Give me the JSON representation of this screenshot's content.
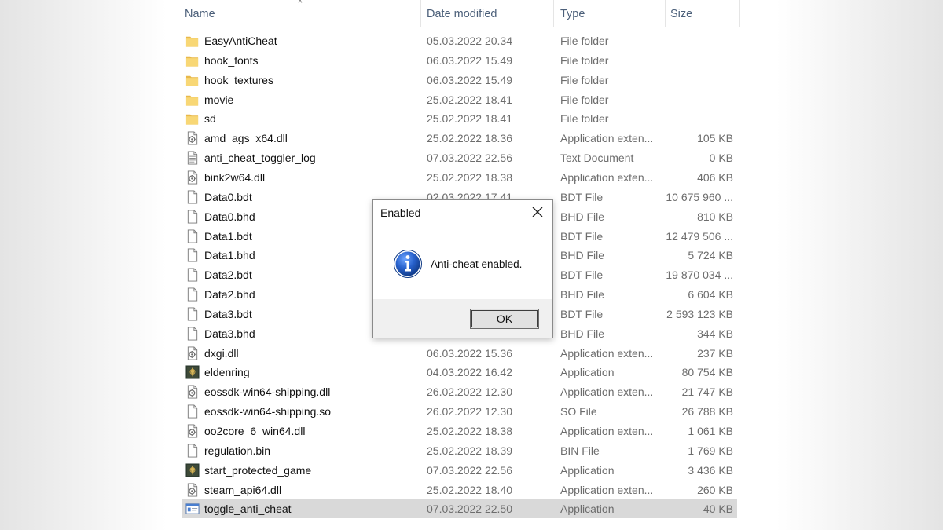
{
  "explorer": {
    "columns": {
      "name": "Name",
      "date_modified": "Date modified",
      "type": "Type",
      "size": "Size"
    },
    "sort_indicator": "^",
    "files": [
      {
        "name": "EasyAntiCheat",
        "date": "05.03.2022 20.34",
        "type": "File folder",
        "size": "",
        "icon": "folder-icon"
      },
      {
        "name": "hook_fonts",
        "date": "06.03.2022 15.49",
        "type": "File folder",
        "size": "",
        "icon": "folder-icon"
      },
      {
        "name": "hook_textures",
        "date": "06.03.2022 15.49",
        "type": "File folder",
        "size": "",
        "icon": "folder-icon"
      },
      {
        "name": "movie",
        "date": "25.02.2022 18.41",
        "type": "File folder",
        "size": "",
        "icon": "folder-icon"
      },
      {
        "name": "sd",
        "date": "25.02.2022 18.41",
        "type": "File folder",
        "size": "",
        "icon": "folder-icon"
      },
      {
        "name": "amd_ags_x64.dll",
        "date": "25.02.2022 18.36",
        "type": "Application exten...",
        "size": "105 KB",
        "icon": "dll-icon"
      },
      {
        "name": "anti_cheat_toggler_log",
        "date": "07.03.2022 22.56",
        "type": "Text Document",
        "size": "0 KB",
        "icon": "text-document-icon"
      },
      {
        "name": "bink2w64.dll",
        "date": "25.02.2022 18.38",
        "type": "Application exten...",
        "size": "406 KB",
        "icon": "dll-icon"
      },
      {
        "name": "Data0.bdt",
        "date": "02.03.2022 17.41",
        "type": "BDT File",
        "size": "10 675 960 ...",
        "icon": "file-icon"
      },
      {
        "name": "Data0.bhd",
        "date": "",
        "type": "BHD File",
        "size": "810 KB",
        "icon": "file-icon"
      },
      {
        "name": "Data1.bdt",
        "date": "",
        "type": "BDT File",
        "size": "12 479 506 ...",
        "icon": "file-icon"
      },
      {
        "name": "Data1.bhd",
        "date": "",
        "type": "BHD File",
        "size": "5 724 KB",
        "icon": "file-icon"
      },
      {
        "name": "Data2.bdt",
        "date": "",
        "type": "BDT File",
        "size": "19 870 034 ...",
        "icon": "file-icon"
      },
      {
        "name": "Data2.bhd",
        "date": "",
        "type": "BHD File",
        "size": "6 604 KB",
        "icon": "file-icon"
      },
      {
        "name": "Data3.bdt",
        "date": "",
        "type": "BDT File",
        "size": "2 593 123 KB",
        "icon": "file-icon"
      },
      {
        "name": "Data3.bhd",
        "date": "",
        "type": "BHD File",
        "size": "344 KB",
        "icon": "file-icon"
      },
      {
        "name": "dxgi.dll",
        "date": "06.03.2022 15.36",
        "type": "Application exten...",
        "size": "237 KB",
        "icon": "dll-icon"
      },
      {
        "name": "eldenring",
        "date": "04.03.2022 16.42",
        "type": "Application",
        "size": "80 754 KB",
        "icon": "game-app-icon"
      },
      {
        "name": "eossdk-win64-shipping.dll",
        "date": "26.02.2022 12.30",
        "type": "Application exten...",
        "size": "21 747 KB",
        "icon": "dll-icon"
      },
      {
        "name": "eossdk-win64-shipping.so",
        "date": "26.02.2022 12.30",
        "type": "SO File",
        "size": "26 788 KB",
        "icon": "file-icon"
      },
      {
        "name": "oo2core_6_win64.dll",
        "date": "25.02.2022 18.38",
        "type": "Application exten...",
        "size": "1 061 KB",
        "icon": "dll-icon"
      },
      {
        "name": "regulation.bin",
        "date": "25.02.2022 18.39",
        "type": "BIN File",
        "size": "1 769 KB",
        "icon": "file-icon"
      },
      {
        "name": "start_protected_game",
        "date": "07.03.2022 22.56",
        "type": "Application",
        "size": "3 436 KB",
        "icon": "game-app-icon"
      },
      {
        "name": "steam_api64.dll",
        "date": "25.02.2022 18.40",
        "type": "Application exten...",
        "size": "260 KB",
        "icon": "dll-icon"
      },
      {
        "name": "toggle_anti_cheat",
        "date": "07.03.2022 22.50",
        "type": "Application",
        "size": "40 KB",
        "icon": "window-app-icon",
        "selected": true
      }
    ]
  },
  "dialog": {
    "title": "Enabled",
    "message": "Anti-cheat enabled.",
    "ok_label": "OK",
    "icon": "info-icon"
  },
  "colors": {
    "header_text": "#4c607a",
    "folder": "#f8d775",
    "selected_row": "#d9d9d9",
    "info_blue": "#1f5bbf"
  }
}
